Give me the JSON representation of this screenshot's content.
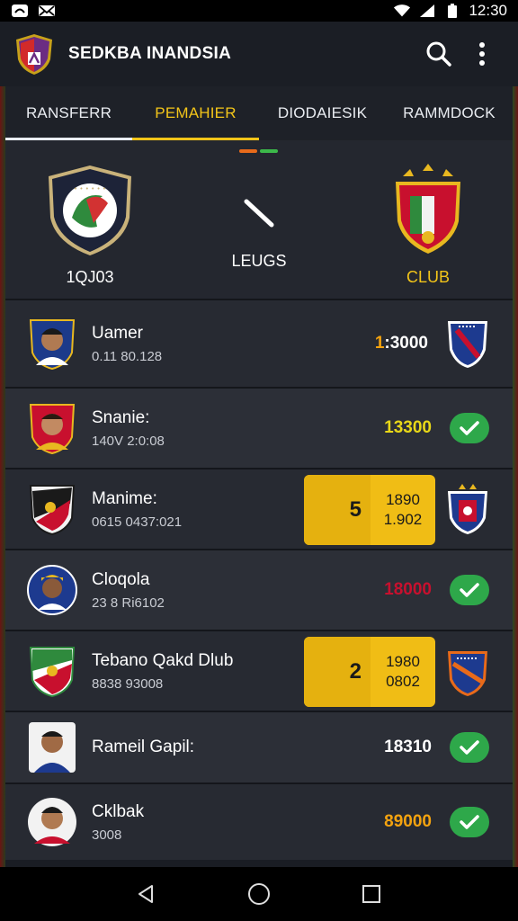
{
  "status": {
    "time": "12:30",
    "left_icons": [
      "sync-icon",
      "mail-icon"
    ],
    "right_icons": [
      "wifi-icon",
      "signal-icon",
      "battery-icon"
    ]
  },
  "app": {
    "title": "SEDKBA INANDSIA",
    "actions": [
      "search-icon",
      "more-vert-icon"
    ]
  },
  "tabs": [
    {
      "label": "RANSFERR",
      "active": false
    },
    {
      "label": "PEMAHIER",
      "active": true
    },
    {
      "label": "DIODAIESIK",
      "active": false
    },
    {
      "label": "RAMMDOCK",
      "active": false
    }
  ],
  "match": {
    "home": {
      "name": "1QJ03"
    },
    "center": {
      "label": "LEUGS"
    },
    "away": {
      "name": "CLUB"
    }
  },
  "players": [
    {
      "name": "Uamer",
      "sub": "0.11 80.128",
      "value_prefix": "1",
      "value": ":3000",
      "indicator": "crest"
    },
    {
      "name": "Snanie:",
      "sub": "140V 2:0:08",
      "value": "13300",
      "indicator": "check"
    },
    {
      "name": "Manime:",
      "sub": "0615 0437:021",
      "highlight": {
        "rank": "5",
        "line1": "1890",
        "line2": "1.902"
      },
      "indicator": "crest"
    },
    {
      "name": "Cloqola",
      "sub": "23 8 Ri6102",
      "value": "18000",
      "indicator": "check"
    },
    {
      "name": "Tebano Qakd Dlub",
      "sub": "8838 93008",
      "highlight": {
        "rank": "2",
        "line1": "1980",
        "line2": "0802"
      },
      "indicator": "crest"
    },
    {
      "name": "Rameil Gapil:",
      "sub": "",
      "value": "18310",
      "indicator": "check"
    },
    {
      "name": "Cklbak",
      "sub": "3008",
      "value": "9000",
      "value_prefix": "8",
      "indicator": "check"
    }
  ],
  "colors": {
    "accent": "#f3c519",
    "value_yellow": "#e9d818",
    "value_red": "#c8102e",
    "value_gold": "#f4a30f",
    "check_green": "#2ea84a",
    "pager_orange": "#e86a1a",
    "pager_green": "#3cb84a"
  },
  "nav": [
    "back-icon",
    "home-icon",
    "recents-icon"
  ]
}
